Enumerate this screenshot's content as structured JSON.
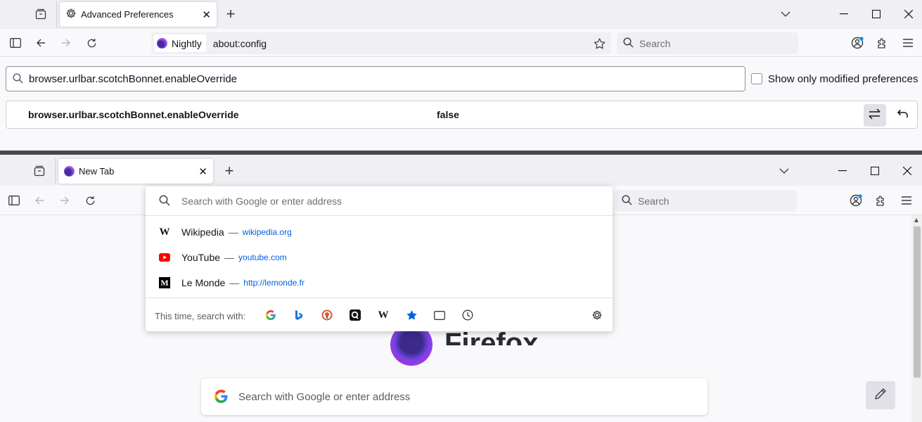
{
  "window1": {
    "tab": {
      "title": "Advanced Preferences"
    },
    "url": {
      "identity_label": "Nightly",
      "address": "about:config"
    },
    "search": {
      "placeholder": "Search"
    },
    "config": {
      "search_value": "browser.urlbar.scotchBonnet.enableOverride",
      "show_modified_label": "Show only modified preferences",
      "pref_name": "browser.urlbar.scotchBonnet.enableOverride",
      "pref_value": "false"
    }
  },
  "window2": {
    "tab": {
      "title": "New Tab"
    },
    "search": {
      "placeholder": "Search"
    },
    "dropdown": {
      "input_placeholder": "Search with Google or enter address",
      "suggestions": [
        {
          "title": "Wikipedia",
          "url": "wikipedia.org",
          "icon": "wikipedia-icon"
        },
        {
          "title": "YouTube",
          "url": "youtube.com",
          "icon": "youtube-icon"
        },
        {
          "title": "Le Monde",
          "url": "http://lemonde.fr",
          "icon": "lemonde-icon"
        }
      ],
      "footer_label": "This time, search with:",
      "engines": [
        "google-icon",
        "bing-icon",
        "duckduckgo-icon",
        "qwant-icon",
        "wikipedia-icon",
        "bookmarks-icon",
        "tabs-icon",
        "history-icon"
      ]
    },
    "newtab": {
      "wordmark": "Firefox",
      "search_placeholder": "Search with Google or enter address"
    }
  },
  "colors": {
    "accent": "#0061e0",
    "youtube": "#ff0000",
    "toggle_bg": "#e0e0e6"
  }
}
